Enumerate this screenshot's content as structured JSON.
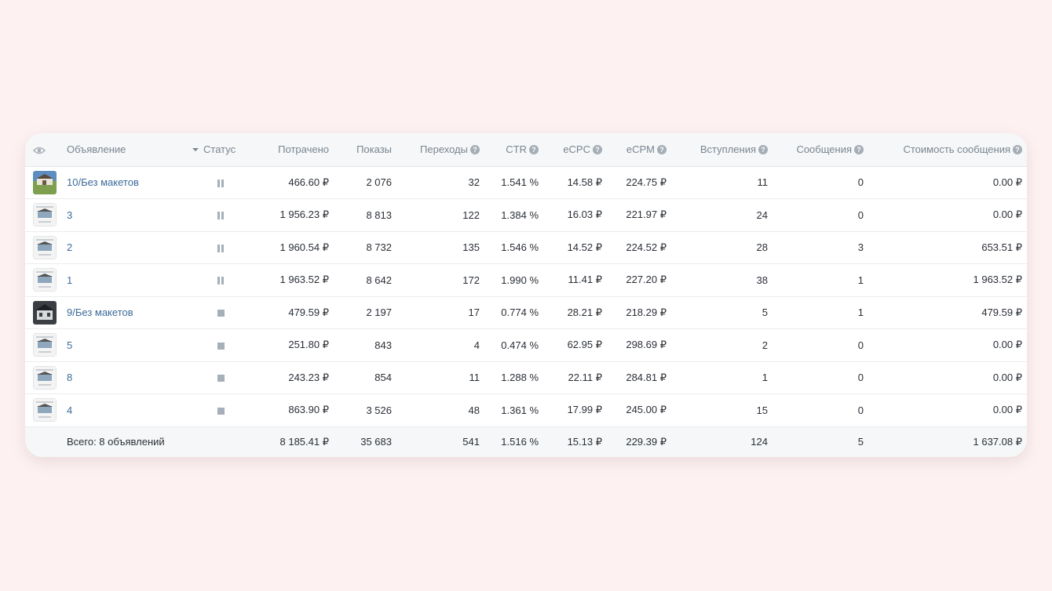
{
  "headers": {
    "ad": "Объявление",
    "status": "Статус",
    "spent": "Потрачено",
    "impressions": "Показы",
    "clicks": "Переходы",
    "ctr": "CTR",
    "ecpc": "eCPC",
    "ecpm": "eCPM",
    "joins": "Вступления",
    "messages": "Сообщения",
    "msg_cost": "Стоимость сообщения"
  },
  "rows": [
    {
      "name": "10/Без макетов",
      "status": "paused",
      "thumb": "house-photo-icon",
      "spent": "466.60 ₽",
      "impressions": "2 076",
      "clicks": "32",
      "ctr": "1.541 %",
      "ecpc": "14.58 ₽",
      "ecpm": "224.75 ₽",
      "joins": "11",
      "messages": "0",
      "msg_cost": "0.00 ₽"
    },
    {
      "name": "3",
      "status": "paused",
      "thumb": "house-card-icon",
      "spent": "1 956.23 ₽",
      "impressions": "8 813",
      "clicks": "122",
      "ctr": "1.384 %",
      "ecpc": "16.03 ₽",
      "ecpm": "221.97 ₽",
      "joins": "24",
      "messages": "0",
      "msg_cost": "0.00 ₽"
    },
    {
      "name": "2",
      "status": "paused",
      "thumb": "house-card-icon",
      "spent": "1 960.54 ₽",
      "impressions": "8 732",
      "clicks": "135",
      "ctr": "1.546 %",
      "ecpc": "14.52 ₽",
      "ecpm": "224.52 ₽",
      "joins": "28",
      "messages": "3",
      "msg_cost": "653.51 ₽"
    },
    {
      "name": "1",
      "status": "paused",
      "thumb": "house-card-icon",
      "spent": "1 963.52 ₽",
      "impressions": "8 642",
      "clicks": "172",
      "ctr": "1.990 %",
      "ecpc": "11.41 ₽",
      "ecpm": "227.20 ₽",
      "joins": "38",
      "messages": "1",
      "msg_cost": "1 963.52 ₽"
    },
    {
      "name": "9/Без макетов",
      "status": "stopped",
      "thumb": "dark-house-icon",
      "spent": "479.59 ₽",
      "impressions": "2 197",
      "clicks": "17",
      "ctr": "0.774 %",
      "ecpc": "28.21 ₽",
      "ecpm": "218.29 ₽",
      "joins": "5",
      "messages": "1",
      "msg_cost": "479.59 ₽"
    },
    {
      "name": "5",
      "status": "stopped",
      "thumb": "house-card-icon",
      "spent": "251.80 ₽",
      "impressions": "843",
      "clicks": "4",
      "ctr": "0.474 %",
      "ecpc": "62.95 ₽",
      "ecpm": "298.69 ₽",
      "joins": "2",
      "messages": "0",
      "msg_cost": "0.00 ₽"
    },
    {
      "name": "8",
      "status": "stopped",
      "thumb": "house-card-icon",
      "spent": "243.23 ₽",
      "impressions": "854",
      "clicks": "11",
      "ctr": "1.288 %",
      "ecpc": "22.11 ₽",
      "ecpm": "284.81 ₽",
      "joins": "1",
      "messages": "0",
      "msg_cost": "0.00 ₽"
    },
    {
      "name": "4",
      "status": "stopped",
      "thumb": "house-card-icon",
      "spent": "863.90 ₽",
      "impressions": "3 526",
      "clicks": "48",
      "ctr": "1.361 %",
      "ecpc": "17.99 ₽",
      "ecpm": "245.00 ₽",
      "joins": "15",
      "messages": "0",
      "msg_cost": "0.00 ₽"
    }
  ],
  "totals": {
    "label": "Всего: 8 объявлений",
    "spent": "8 185.41 ₽",
    "impressions": "35 683",
    "clicks": "541",
    "ctr": "1.516 %",
    "ecpc": "15.13 ₽",
    "ecpm": "229.39 ₽",
    "joins": "124",
    "messages": "5",
    "msg_cost": "1 637.08 ₽"
  },
  "colors": {
    "link": "#3c6b99",
    "header_text": "#7a8591",
    "background": "#fdf1f1"
  }
}
